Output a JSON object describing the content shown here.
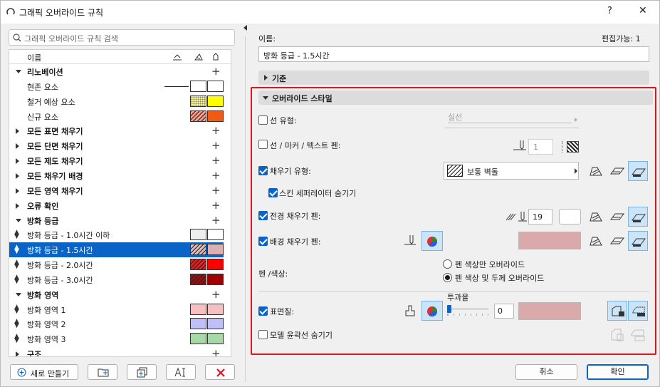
{
  "window": {
    "title": "그래픽 오버라이드 규칙",
    "help_label": "?",
    "close_label": "✕"
  },
  "left": {
    "search_placeholder": "그래픽 오버라이드 규칙 검색",
    "header": {
      "name_col": "이름"
    },
    "tree": [
      {
        "kind": "group",
        "label": "리노베이션",
        "expanded": true
      },
      {
        "kind": "item",
        "label": "현존 요소",
        "sw1": "#ffffff",
        "sw2": "#ffffff",
        "line": true
      },
      {
        "kind": "item",
        "label": "철거 예상 요소",
        "sw1": "#f6f08a",
        "sw2": "#ffff00",
        "dots": true
      },
      {
        "kind": "item",
        "label": "신규 요소",
        "sw1": "#f79a8a",
        "sw2": "#f05a14",
        "hatch": true
      },
      {
        "kind": "group",
        "label": "모든 표면 채우기"
      },
      {
        "kind": "group",
        "label": "모든 단면 채우기"
      },
      {
        "kind": "group",
        "label": "모든 제도 채우기"
      },
      {
        "kind": "group",
        "label": "모든 채우기 배경"
      },
      {
        "kind": "group",
        "label": "모든 영역 채우기"
      },
      {
        "kind": "group",
        "label": "오류 확인"
      },
      {
        "kind": "group",
        "label": "방화 등급",
        "expanded": true
      },
      {
        "kind": "rule",
        "label": "방화 등급 - 1.0시간 이하",
        "sw1": "#eeeeee",
        "sw2": "#ffffff"
      },
      {
        "kind": "rule",
        "label": "방화 등급 - 1.5시간",
        "sw1": "#dcbcbc",
        "sw2": "#dcb0b0",
        "hatch": true,
        "selected": true
      },
      {
        "kind": "rule",
        "label": "방화 등급 - 2.0시간",
        "sw1": "#e02020",
        "sw2": "#ff0000",
        "hatch": true
      },
      {
        "kind": "rule",
        "label": "방화 등급 - 3.0시간",
        "sw1": "#9a1010",
        "sw2": "#a00000",
        "hatch": true
      },
      {
        "kind": "group",
        "label": "방화 영역",
        "expanded": true
      },
      {
        "kind": "rule",
        "label": "방화 영역 1",
        "sw1": "#f7c0c0",
        "sw2": "#f7c0c0"
      },
      {
        "kind": "rule",
        "label": "방화 영역 2",
        "sw1": "#c0c0f7",
        "sw2": "#c0c0f7"
      },
      {
        "kind": "rule",
        "label": "방화 영역 3",
        "sw1": "#a8d8a8",
        "sw2": "#a8d8a8"
      },
      {
        "kind": "group",
        "label": "구조"
      }
    ],
    "new_button": "새로 만들기",
    "delete_icon": "delete-x-icon"
  },
  "right": {
    "name_label": "이름:",
    "editable": "편집가능: 1",
    "name_value": "방화 등급 - 1.5시간",
    "criteria": "기준",
    "override_style": "오버라이드 스타일",
    "line_type": {
      "label": "선 유형:",
      "value": "실선"
    },
    "pen": {
      "label": "선 / 마커 / 텍스트 펜:",
      "value": "1"
    },
    "fill_type": {
      "label": "채우기 유형:",
      "value": "보통 벽돌"
    },
    "skin_sep": "스킨 세퍼레이터 숨기기",
    "fg_pen": {
      "label": "전경 채우기 펜:",
      "value": "19"
    },
    "bg_pen": {
      "label": "배경 채우기 펜:"
    },
    "pen_color": {
      "label": "펜 /색상:",
      "opt1": "펜 색상만 오버라이드",
      "opt2": "펜 색상 및 두께 오버라이드"
    },
    "transparency": "투과율",
    "surface": {
      "label": "표면질:",
      "value": "0"
    },
    "model_contour": "모델 윤곽선 숨기기",
    "cancel": "취소",
    "ok": "확인",
    "accent": "#0a64c8",
    "highlight_box": "#e0141e"
  }
}
